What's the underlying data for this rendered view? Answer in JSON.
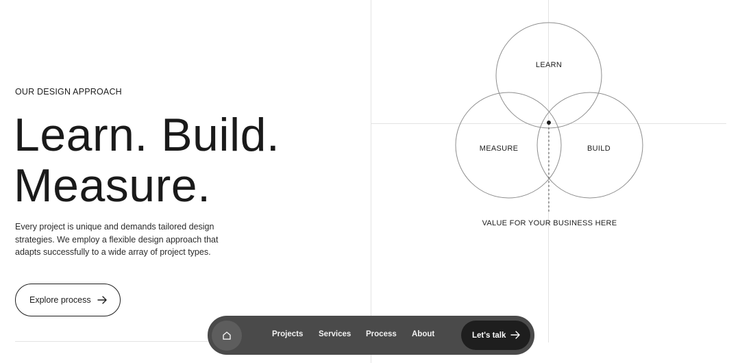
{
  "hero": {
    "eyebrow": "OUR DESIGN APPROACH",
    "headline_line1": "Learn. Build.",
    "headline_line2": "Measure.",
    "description": "Every project is unique and demands tailored design strategies. We employ a flexible design approach that adapts successfully to a wide array of project types.",
    "cta_label": "Explore process",
    "cta_icon": "arrow-right-icon"
  },
  "diagram": {
    "labels": {
      "learn": "LEARN",
      "measure": "MEASURE",
      "build": "BUILD",
      "value": "VALUE FOR YOUR BUSINESS HERE"
    }
  },
  "nav": {
    "home_icon": "home-icon",
    "links": [
      "Projects",
      "Services",
      "Process",
      "About"
    ],
    "cta_label": "Let's talk",
    "cta_icon": "arrow-right-icon",
    "colors": {
      "bar": "#4a4a4a",
      "home_bg": "#5d5d5d",
      "cta_bg": "#1e1e1e"
    }
  }
}
